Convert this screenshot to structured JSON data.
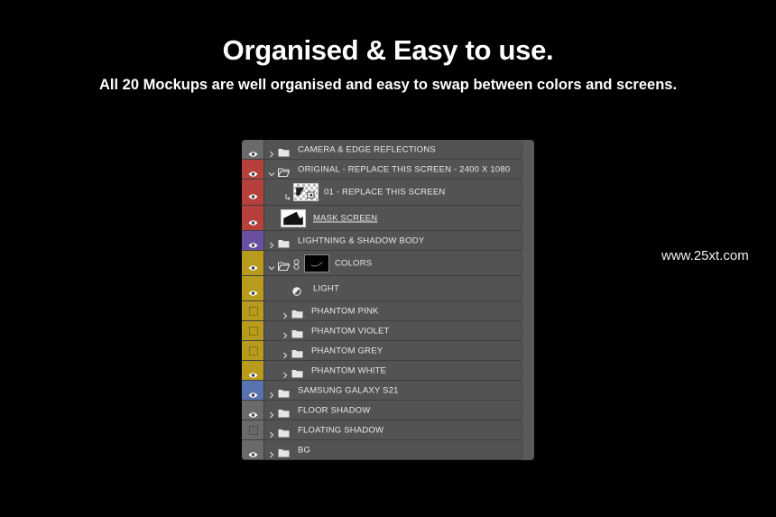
{
  "header": {
    "title": "Organised & Easy to use.",
    "subtitle": "All 20 Mockups are well organised and easy to swap between colors and screens."
  },
  "watermark": "www.25xt.com",
  "colors": {
    "gray": "#6a6a6a",
    "red": "#b5403c",
    "purple": "#6a4fa3",
    "yellow": "#b89a1c",
    "blue": "#5873b0"
  },
  "layers": [
    {
      "label": "CAMERA & EDGE REFLECTIONS",
      "color": "gray",
      "visible": true,
      "type": "group",
      "expanded": false
    },
    {
      "label": "ORIGINAL - REPLACE THIS SCREEN - 2400 X 1080",
      "color": "red",
      "visible": true,
      "type": "group",
      "expanded": true
    },
    {
      "label": "01 - REPLACE THIS SCREEN",
      "color": "red",
      "visible": true,
      "type": "smart-object"
    },
    {
      "label": "MASK SCREEN",
      "color": "red",
      "visible": true,
      "type": "mask"
    },
    {
      "label": "LIGHTNING & SHADOW BODY",
      "color": "purple",
      "visible": true,
      "type": "group",
      "expanded": false
    },
    {
      "label": "COLORS",
      "color": "yellow",
      "visible": true,
      "type": "masked-group",
      "expanded": true
    },
    {
      "label": "LIGHT",
      "color": "yellow",
      "visible": true,
      "type": "adjustment"
    },
    {
      "label": "PHANTOM PINK",
      "color": "yellow",
      "visible": false,
      "type": "group",
      "expanded": false
    },
    {
      "label": "PHANTOM VIOLET",
      "color": "yellow",
      "visible": false,
      "type": "group",
      "expanded": false
    },
    {
      "label": "PHANTOM GREY",
      "color": "yellow",
      "visible": false,
      "type": "group",
      "expanded": false
    },
    {
      "label": "PHANTOM WHITE",
      "color": "yellow",
      "visible": true,
      "type": "group",
      "expanded": false
    },
    {
      "label": "SAMSUNG GALAXY S21",
      "color": "blue",
      "visible": true,
      "type": "group",
      "expanded": false
    },
    {
      "label": "FLOOR SHADOW",
      "color": "gray",
      "visible": true,
      "type": "group",
      "expanded": false
    },
    {
      "label": "FLOATING SHADOW",
      "color": "gray",
      "visible": false,
      "type": "group",
      "expanded": false
    },
    {
      "label": "BG",
      "color": "gray",
      "visible": true,
      "type": "group",
      "expanded": false
    }
  ]
}
